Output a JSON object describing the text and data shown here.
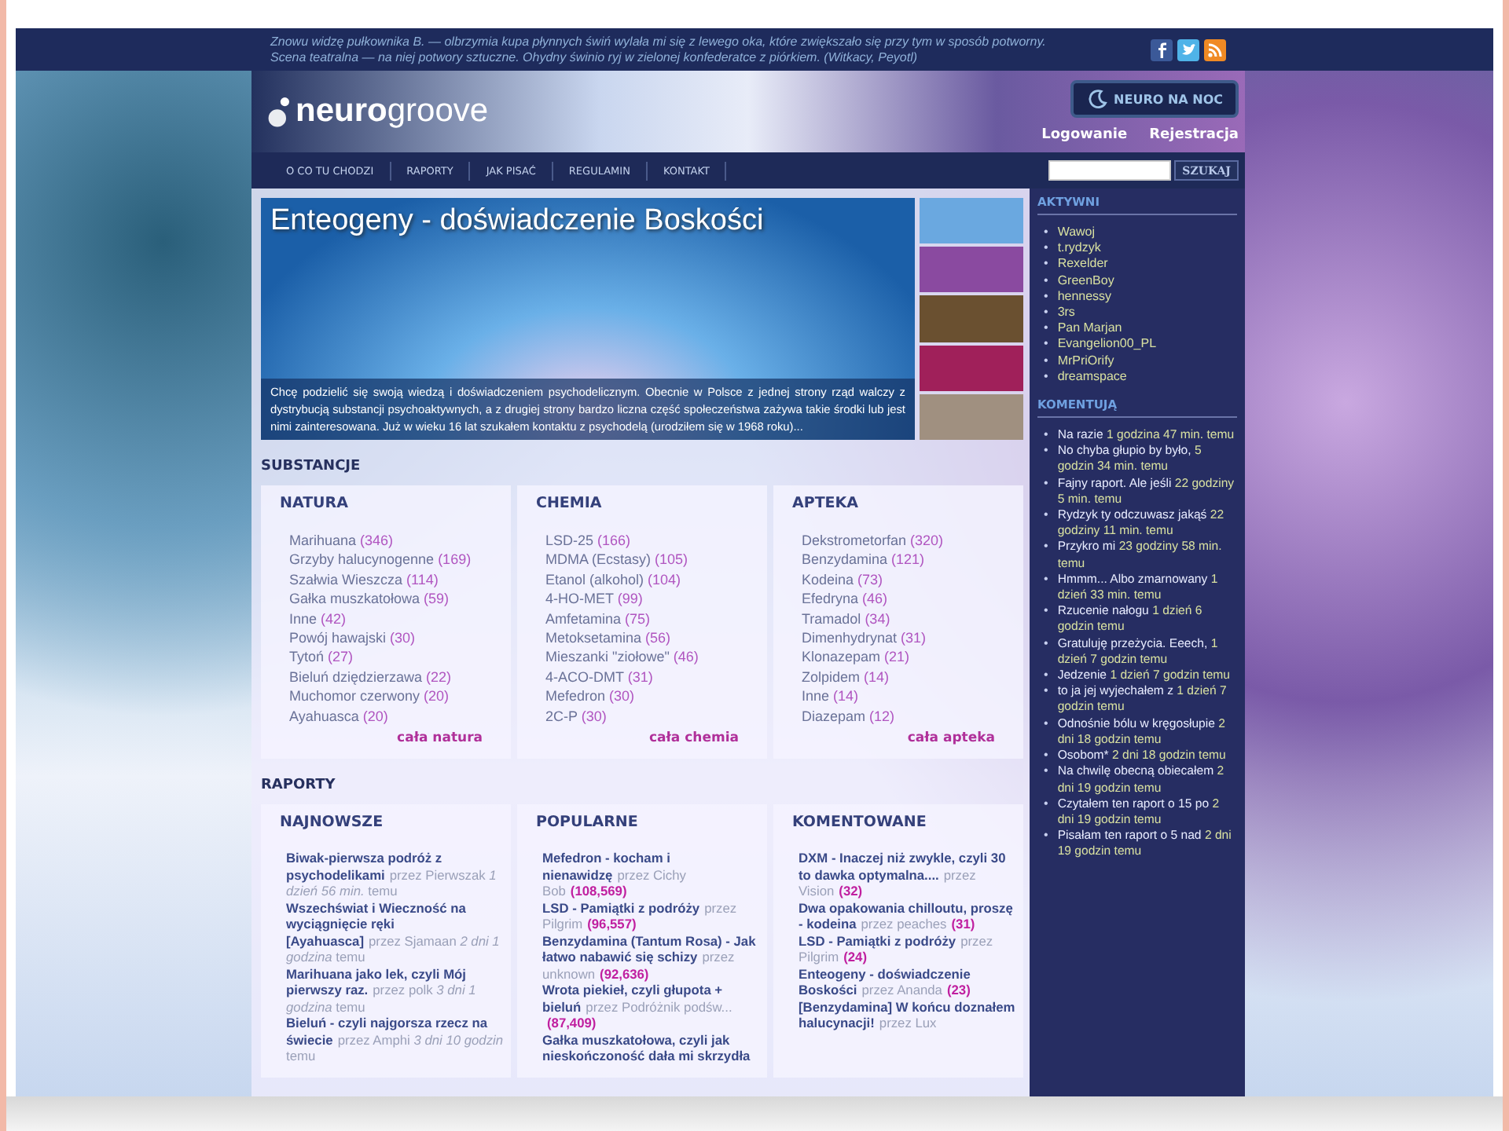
{
  "quote": {
    "line_1": "Znowu widzę pułkownika B. — olbrzymia kupa płynnych świń wylała mi się z lewego oka, które zwiększało się przy tym w sposób potworny.",
    "line_2": "Scena teatralna — na niej potwory sztuczne. Ohydny świnio ryj w zielonej konfederatce z piórkiem. (Witkacy, Peyotl)"
  },
  "logo": "**neuro**groove",
  "night_button": "NEURO NA NOC",
  "auth_links": [
    "Logowanie",
    "Rejestracja"
  ],
  "nav": [
    {
      "label": "O CO TU CHODZI",
      "selected": false
    },
    {
      "label": "RAPORTY",
      "selected": false
    },
    {
      "label": "JAK PISAĆ",
      "selected": false
    },
    {
      "label": "REGULAMIN",
      "selected": false
    },
    {
      "label": "KONTAKT",
      "selected": false
    }
  ],
  "search": {
    "button": "SZUKAJ"
  },
  "hero": {
    "title": "Enteogeny - doświadczenie Boskości",
    "text": "Chcę podzielić się swoją wiedzą i doświadczeniem psychodelicznym. Obecnie w Polsce z jednej strony rząd walczy z dystrybucją substancji psychoaktywnych, a z drugiej strony bardzo liczna część społeczeństwa zażywa takie środki lub jest nimi zainteresowana.  Już w wieku 16 lat szukałem kontaktu z psychodelą (urodziłem się w 1968 roku)..."
  },
  "substances": {
    "title": "SUBSTANCJE",
    "columns": [
      {
        "title": "NATURA",
        "items": [
          [
            "Marihuana",
            "(346)"
          ],
          [
            "Grzyby halucynogenne",
            "(169)"
          ],
          [
            "Szałwia Wieszcza",
            "(114)"
          ],
          [
            "Gałka muszkatołowa",
            "(59)"
          ],
          [
            "Inne",
            "(42)"
          ],
          [
            "Powój hawajski",
            "(30)"
          ],
          [
            "Tytoń",
            "(27)"
          ],
          [
            "Bieluń dziędzierzawa",
            "(22)"
          ],
          [
            "Muchomor czerwony",
            "(20)"
          ],
          [
            "Ayahuasca",
            "(20)"
          ]
        ],
        "more": "cała natura"
      },
      {
        "title": "CHEMIA",
        "items": [
          [
            "LSD-25",
            "(166)"
          ],
          [
            "MDMA (Ecstasy)",
            "(105)"
          ],
          [
            "Etanol (alkohol)",
            "(104)"
          ],
          [
            "4-HO-MET",
            "(99)"
          ],
          [
            "Amfetamina",
            "(75)"
          ],
          [
            "Metoksetamina",
            "(56)"
          ],
          [
            "Mieszanki \"ziołowe\"",
            "(46)"
          ],
          [
            "4-ACO-DMT",
            "(31)"
          ],
          [
            "Mefedron",
            "(30)"
          ],
          [
            "2C-P",
            "(30)"
          ]
        ],
        "more": "cała chemia"
      },
      {
        "title": "APTEKA",
        "items": [
          [
            "Dekstrometorfan",
            "(320)"
          ],
          [
            "Benzydamina",
            "(121)"
          ],
          [
            "Kodeina",
            "(73)"
          ],
          [
            "Efedryna",
            "(46)"
          ],
          [
            "Tramadol",
            "(34)"
          ],
          [
            "Dimenhydrynat",
            "(31)"
          ],
          [
            "Klonazepam",
            "(21)"
          ],
          [
            "Zolpidem",
            "(14)"
          ],
          [
            "Inne",
            "(14)"
          ],
          [
            "Diazepam",
            "(12)"
          ]
        ],
        "more": "cała apteka"
      }
    ]
  },
  "reports": {
    "title": "RAPORTY",
    "columns": [
      {
        "title": "NAJNOWSZE",
        "items": [
          {
            "title": "Biwak-pierwsza podróż z psychodelikami",
            "meta": "przez Pierwszak *1 dzień 56 min.* temu"
          },
          {
            "title": "Wszechświat i Wieczność na wyciągnięcie ręki [Ayahuasca]",
            "meta": "przez Sjamaan *2 dni 1 godzina* temu"
          },
          {
            "title": "Marihuana jako lek, czyli Mój pierwszy raz.",
            "meta": "przez polk *3 dni 1 godzina* temu"
          },
          {
            "title": "Bieluń - czyli najgorsza rzecz na świecie",
            "meta": "przez Amphi *3 dni 10 godzin* temu"
          }
        ]
      },
      {
        "title": "POPULARNE",
        "items": [
          {
            "title": "Mefedron - kocham i nienawidzę",
            "meta": "przez Cichy Bob",
            "count": "(108,569)"
          },
          {
            "title": "LSD - Pamiątki z podróży",
            "meta": "przez Pilgrim",
            "count": "(96,557)"
          },
          {
            "title": "Benzydamina (Tantum Rosa) - Jak łatwo nabawić się schizy",
            "meta": "przez unknown",
            "count": "(92,636)"
          },
          {
            "title": "Wrota piekieł, czyli głupota + bieluń",
            "meta": "przez Podróżnik podśw...",
            "count": "(87,409)"
          },
          {
            "title": "Gałka muszkatołowa, czyli jak nieskończoność dała mi skrzydła"
          }
        ]
      },
      {
        "title": "KOMENTOWANE",
        "items": [
          {
            "title": "DXM - Inaczej niż zwykle, czyli 30 to dawka optymalna....",
            "meta": "przez Vision",
            "count": "(32)"
          },
          {
            "title": "Dwa opakowania chilloutu, proszę - kodeina",
            "meta": "przez peaches",
            "count": "(31)"
          },
          {
            "title": "LSD - Pamiątki z podróży",
            "meta": "przez Pilgrim",
            "count": "(24)"
          },
          {
            "title": "Enteogeny - doświadczenie Boskości",
            "meta": "przez Ananda",
            "count": "(23)"
          },
          {
            "title": "[Benzydamina] W końcu doznałem halucynacji!",
            "meta": "przez Lux"
          }
        ]
      }
    ]
  },
  "active": {
    "title": "AKTYWNI",
    "bullet": "•",
    "users": [
      "Wawoj",
      "t.rydzyk",
      "Rexelder",
      "GreenBoy",
      "hennessy",
      "3rs",
      "Pan Marjan",
      "Evangelion00_PL",
      "MrPriOrify",
      "dreamspace"
    ]
  },
  "comments": {
    "title": "KOMENTUJĄ",
    "bullet": "•",
    "items": [
      {
        "text": "Na razie",
        "time": "1 godzina 47 min. temu"
      },
      {
        "text": "No chyba głupio by było,",
        "time": "5 godzin 34 min. temu"
      },
      {
        "text": "Fajny raport. Ale jeśli",
        "time": "22 godziny 5 min. temu"
      },
      {
        "text": "Rydzyk ty odczuwasz jakąś",
        "time": "22 godziny 11 min. temu"
      },
      {
        "text": "Przykro mi",
        "time": "23 godziny 58 min. temu"
      },
      {
        "text": "Hmmm... Albo zmarnowany",
        "time": "1 dzień 33 min. temu"
      },
      {
        "text": "Rzucenie nałogu",
        "time": "1 dzień 6 godzin temu"
      },
      {
        "text": "Gratuluję przeżycia. Eeech,",
        "time": "1 dzień 7 godzin temu"
      },
      {
        "text": "Jedzenie",
        "time": "1 dzień 7 godzin temu"
      },
      {
        "text": "to ja jej wyjechałem z",
        "time": "1 dzień 7 godzin temu"
      },
      {
        "text": "Odnośnie bólu w kręgosłupie",
        "time": "2 dni 18 godzin temu"
      },
      {
        "text": "Osobom*",
        "time": "2 dni 18 godzin temu"
      },
      {
        "text": "Na chwilę obecną obiecałem",
        "time": "2 dni 19 godzin temu"
      },
      {
        "text": "Czytałem ten raport o 15 po",
        "time": "2 dni 19 godzin temu"
      },
      {
        "text": "Pisałam ten raport o 5 nad",
        "time": "2 dni 19 godzin temu"
      }
    ]
  }
}
